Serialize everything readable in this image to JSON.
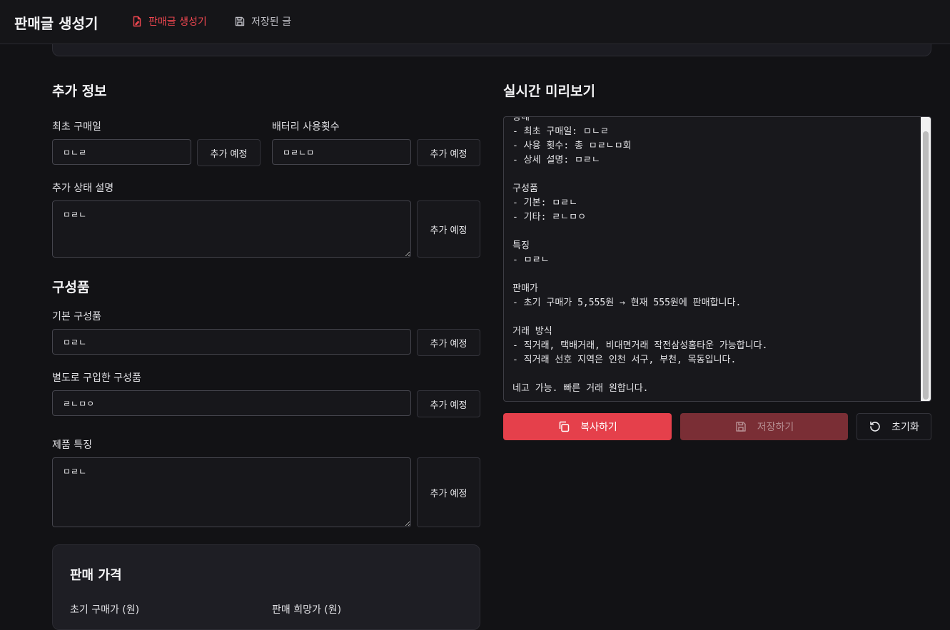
{
  "nav": {
    "brand": "판매글 생성기",
    "active_tab": "판매글 생성기",
    "saved_tab": "저장된 글"
  },
  "extra_info": {
    "title": "추가 정보",
    "first_purchase_label": "최초 구매일",
    "first_purchase_value": "ㅁㄴㄹ",
    "battery_label": "배터리 사용횟수",
    "battery_value": "ㅁㄹㄴㅁ",
    "condition_label": "추가 상태 설명",
    "condition_value": "ㅁㄹㄴ",
    "add_button": "추가 예정"
  },
  "components": {
    "title": "구성품",
    "basic_label": "기본 구성품",
    "basic_value": "ㅁㄹㄴ",
    "extra_label": "별도로 구입한 구성품",
    "extra_value": "ㄹㄴㅁㅇ",
    "features_label": "제품 특징",
    "features_value": "ㅁㄹㄴ",
    "add_button": "추가 예정"
  },
  "price": {
    "title": "판매 가격",
    "initial_label": "초기 구매가 (원)",
    "desired_label": "판매 희망가 (원)"
  },
  "preview": {
    "title": "실시간 미리보기",
    "text": "상태\n- 최초 구매일: ㅁㄴㄹ\n- 사용 횟수: 총 ㅁㄹㄴㅁ회\n- 상세 설명: ㅁㄹㄴ\n\n구성품\n- 기본: ㅁㄹㄴ\n- 기타: ㄹㄴㅁㅇ\n\n특징\n- ㅁㄹㄴ\n\n판매가\n- 초기 구매가 5,555원 → 현재 555원에 판매합니다.\n\n거래 방식\n- 직거래, 택배거래, 비대면거래 작전삼성홈타운 가능합니다.\n- 직거래 선호 지역은 인천 서구, 부천, 목동입니다.\n\n네고 가능. 빠른 거래 원합니다."
  },
  "actions": {
    "copy": "복사하기",
    "save": "저장하기",
    "reset": "초기화"
  },
  "colors": {
    "accent": "#e5404b",
    "background": "#121215"
  }
}
